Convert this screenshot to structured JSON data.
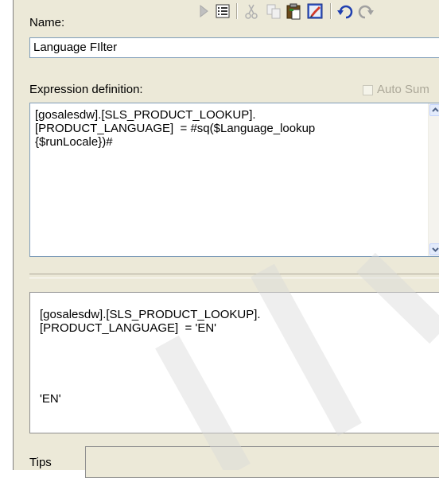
{
  "name_section": {
    "label": "Name:",
    "value": "Language FIlter"
  },
  "toolbar": {
    "icons": [
      "run-icon",
      "properties-icon",
      "cut-icon",
      "copy-icon",
      "paste-icon",
      "edit-icon",
      "undo-icon",
      "redo-icon"
    ]
  },
  "expression_section": {
    "label": "Expression definition:",
    "auto_sum_label": "Auto Sum",
    "text": "[gosalesdw].[SLS_PRODUCT_LOOKUP].\n[PRODUCT_LANGUAGE]  = #sq($Language_lookup\n{$runLocale})#"
  },
  "preview": {
    "text": "[gosalesdw].[SLS_PRODUCT_LOOKUP].\n[PRODUCT_LANGUAGE]  = 'EN'",
    "value": "'EN'"
  },
  "tips": {
    "label": "Tips"
  },
  "colors": {
    "panel_bg": "#ece9d8",
    "field_border": "#7f9db9",
    "disabled_text": "#aca899"
  }
}
